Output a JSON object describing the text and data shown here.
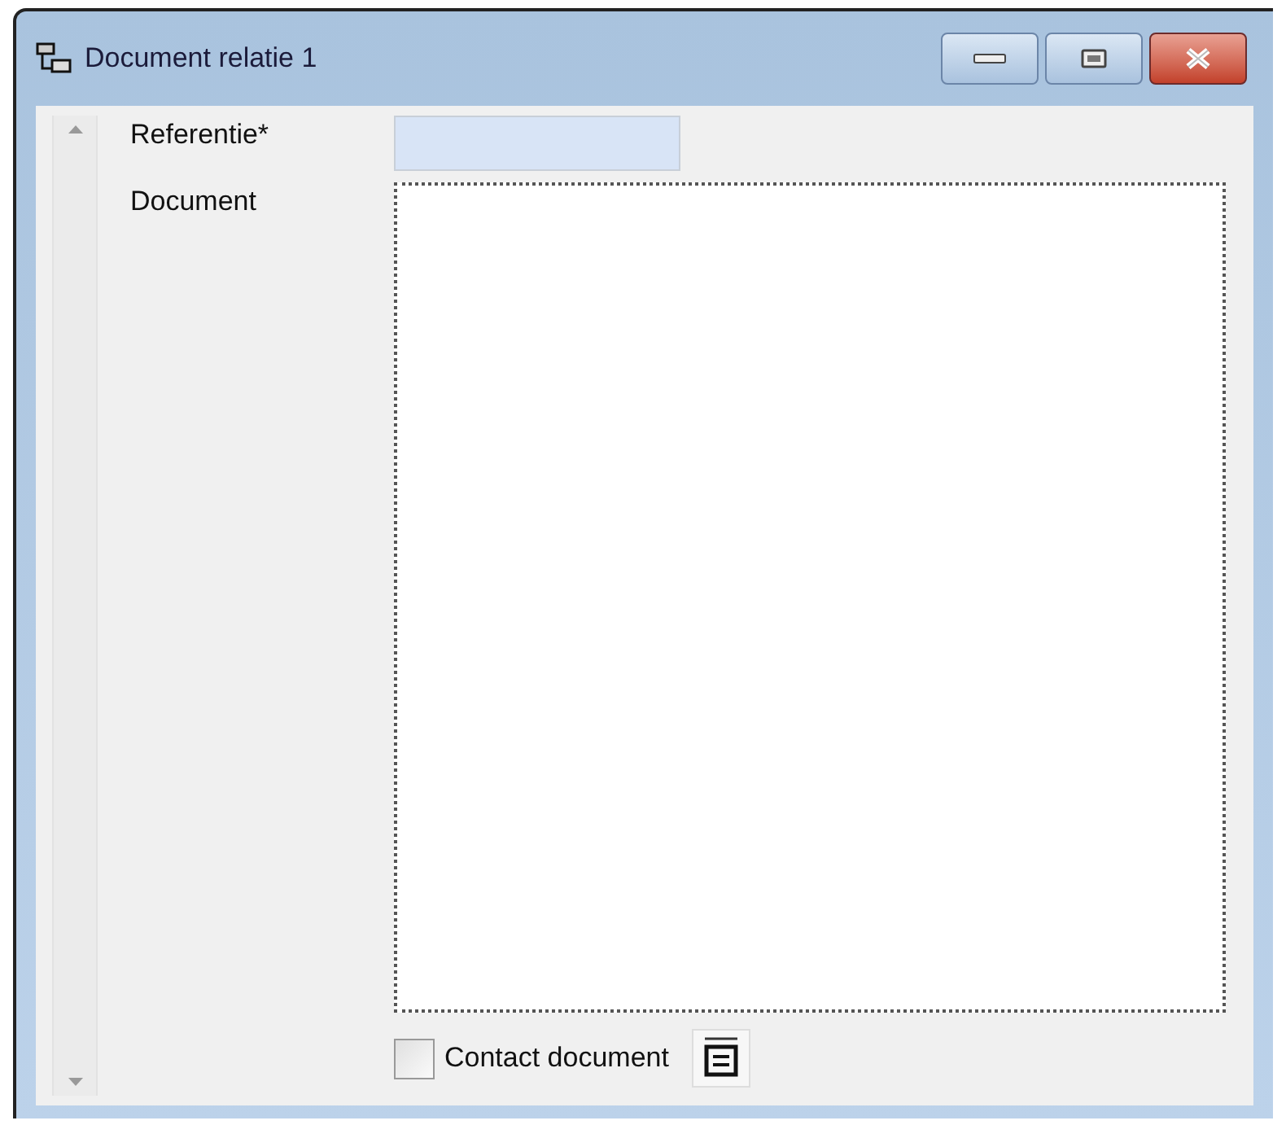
{
  "window": {
    "title": "Document relatie 1"
  },
  "fields": [
    {
      "label": "Referentie*",
      "kind": "text"
    },
    {
      "label": "Document",
      "kind": "document"
    }
  ],
  "contact_document": {
    "label": "Contact document",
    "checked": false
  }
}
